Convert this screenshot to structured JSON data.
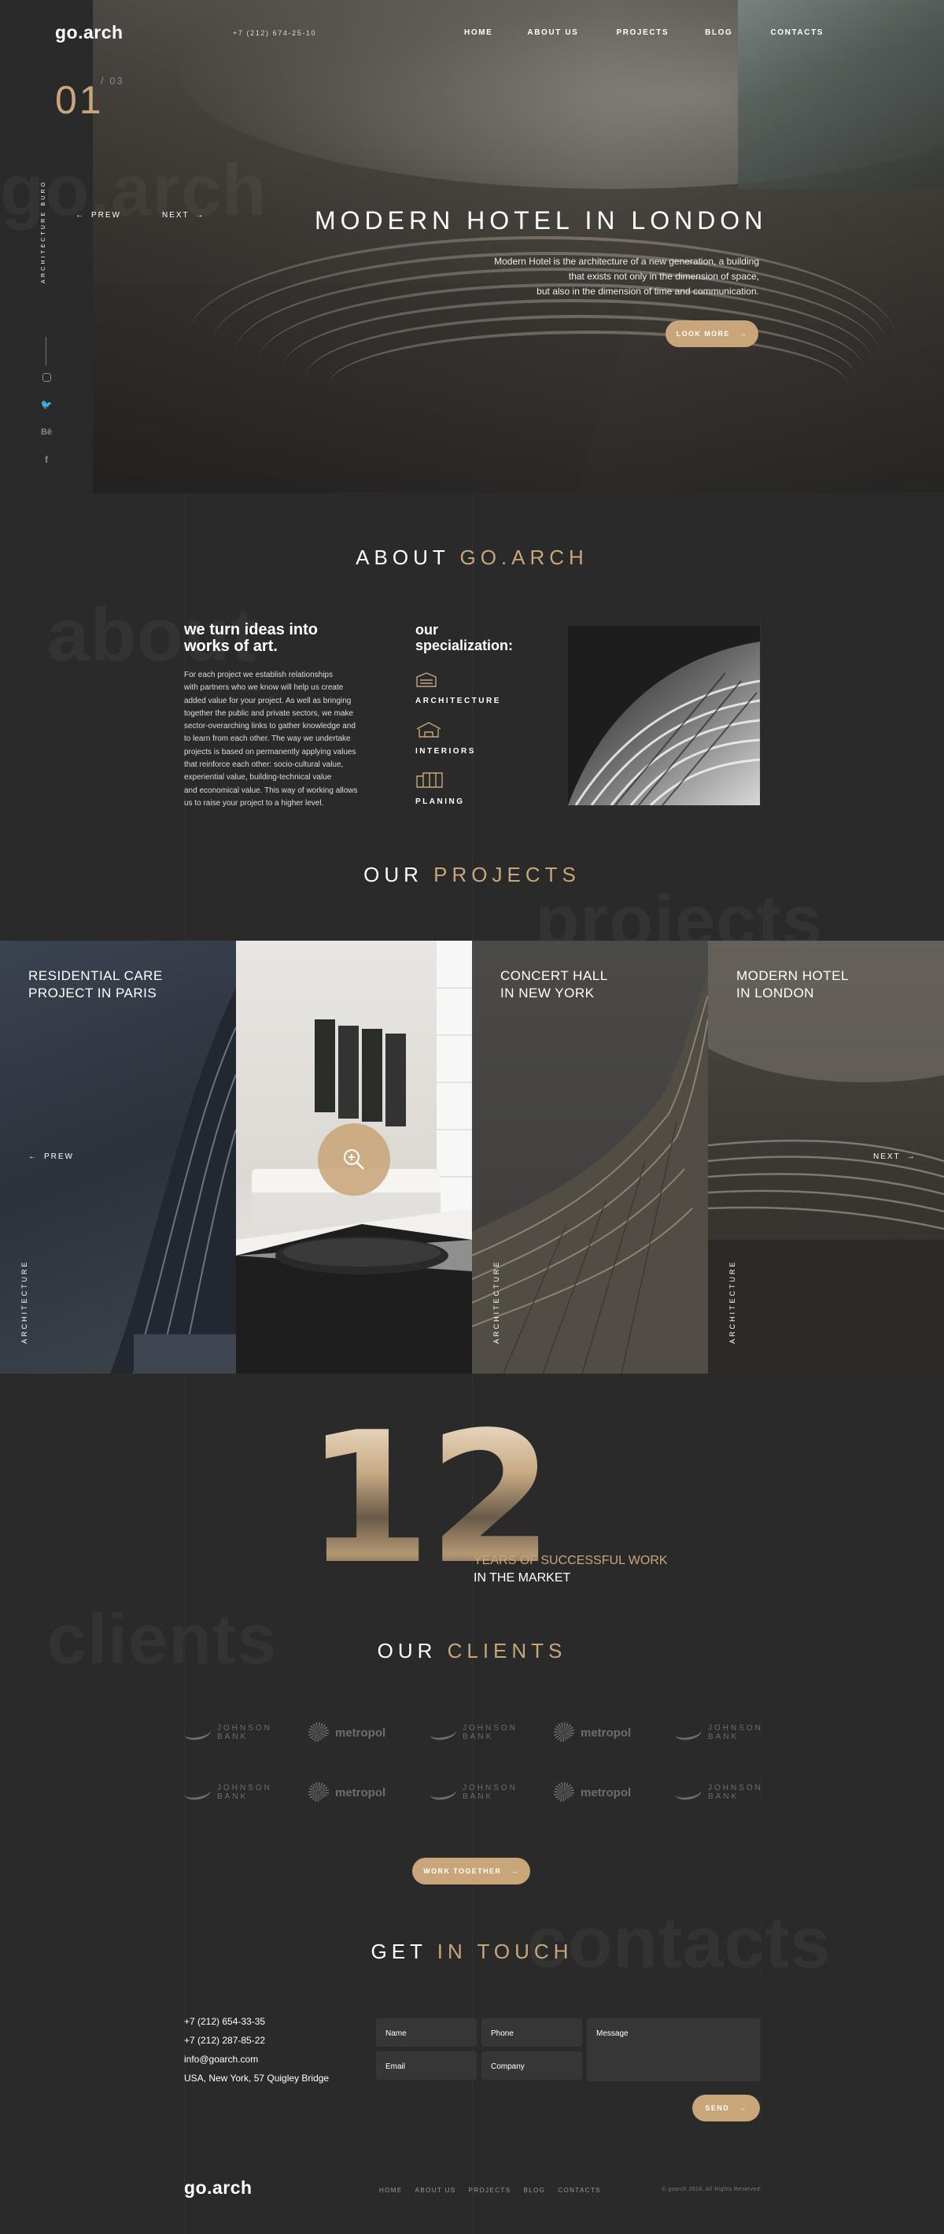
{
  "header": {
    "logo": "go.arch",
    "phone": "+7 (212) 674-25-10",
    "nav": [
      "HOME",
      "ABOUT US",
      "PROJECTS",
      "BLOG",
      "CONTACTS"
    ]
  },
  "hero": {
    "slide_current": "01",
    "slide_total": "/ 03",
    "side_label": "ARCHITECTURE BURO",
    "prev_label": "PREW",
    "next_label": "NEXT",
    "ghost_text": "go.arch",
    "title": "MODERN HOTEL IN LONDON",
    "desc_line1": "Modern Hotel is the architecture of a new generation, a building",
    "desc_line2": "that exists not only in the dimension of space,",
    "desc_line3": "but also in the dimension of time and communication.",
    "cta_label": "LOOK MORE",
    "social_icons": [
      "instagram-icon",
      "twitter-icon",
      "behance-icon",
      "facebook-icon"
    ]
  },
  "about": {
    "title_white": "ABOUT ",
    "title_gold": "GO.ARCH",
    "ghost_text": "about",
    "heading_line1": "we turn ideas into",
    "heading_line2": "works of art.",
    "body": [
      "For each project we establish relationships",
      "with partners who we know will help us create",
      "added value for your project. As well as bringing",
      "together the public and private sectors, we make",
      "sector-overarching links to gather knowledge and",
      "to learn from each other. The way we undertake",
      "projects is based on permanently applying values",
      "that reinforce each other: socio-cultural value,",
      "experiential value, building-technical value",
      "and economical value. This way of working allows",
      "us to raise your project to a higher level."
    ],
    "spec_heading_line1": "our",
    "spec_heading_line2": "specialization:",
    "specializations": [
      "ARCHITECTURE",
      "INTERIORS",
      "PLANING"
    ]
  },
  "projects": {
    "title_white": "OUR ",
    "title_gold": "PROJECTS",
    "ghost_text": "projects",
    "prev_label": "PREW",
    "next_label": "NEXT",
    "items": [
      {
        "title_line1": "RESIDENTIAL CARE",
        "title_line2": "PROJECT IN PARIS",
        "category": "ARCHITECTURE"
      },
      {
        "title_line1": "",
        "title_line2": "",
        "category": ""
      },
      {
        "title_line1": "CONCERT HALL",
        "title_line2": "IN NEW YORK",
        "category": "ARCHITECTURE"
      },
      {
        "title_line1": "MODERN HOTEL",
        "title_line2": "IN LONDON",
        "category": "ARCHITECTURE"
      }
    ]
  },
  "stats": {
    "number": "12",
    "line1": "YEARS OF SUCCESSFUL WORK",
    "line2": "IN THE MARKET"
  },
  "clients": {
    "title_white": "OUR ",
    "title_gold": "CLIENTS",
    "ghost_text": "clients",
    "logos": [
      {
        "type": "johnson",
        "line1": "JOHNSON",
        "line2": "BANK"
      },
      {
        "type": "metropol",
        "line1": "metropol",
        "line2": ""
      },
      {
        "type": "johnson",
        "line1": "JOHNSON",
        "line2": "BANK"
      },
      {
        "type": "metropol",
        "line1": "metropol",
        "line2": ""
      },
      {
        "type": "johnson",
        "line1": "JOHNSON",
        "line2": "BANK"
      },
      {
        "type": "johnson",
        "line1": "JOHNSON",
        "line2": "BANK"
      },
      {
        "type": "metropol",
        "line1": "metropol",
        "line2": ""
      },
      {
        "type": "johnson",
        "line1": "JOHNSON",
        "line2": "BANK"
      },
      {
        "type": "metropol",
        "line1": "metropol",
        "line2": ""
      },
      {
        "type": "johnson",
        "line1": "JOHNSON",
        "line2": "BANK"
      }
    ],
    "cta_label": "WORK TOGETHER"
  },
  "contact": {
    "title_white": "GET ",
    "title_gold": "IN TOUCH",
    "ghost_text": "contacts",
    "phone1": "+7 (212) 654-33-35",
    "phone2": "+7 (212) 287-85-22",
    "email": "info@goarch.com",
    "address": "USA, New York, 57 Quigley Bridge",
    "placeholders": {
      "name": "Name",
      "phone": "Phone",
      "message": "Message",
      "email": "Email",
      "company": "Company"
    },
    "send_label": "SEND"
  },
  "footer": {
    "logo": "go.arch",
    "nav": [
      "HOME",
      "ABOUT US",
      "PROJECTS",
      "BLOG",
      "CONTACTS"
    ],
    "copyright": "© goarch 2016. All Rights Reserved"
  },
  "colors": {
    "accent": "#c9a57a",
    "background": "#2a2a2b",
    "field": "#363637"
  }
}
